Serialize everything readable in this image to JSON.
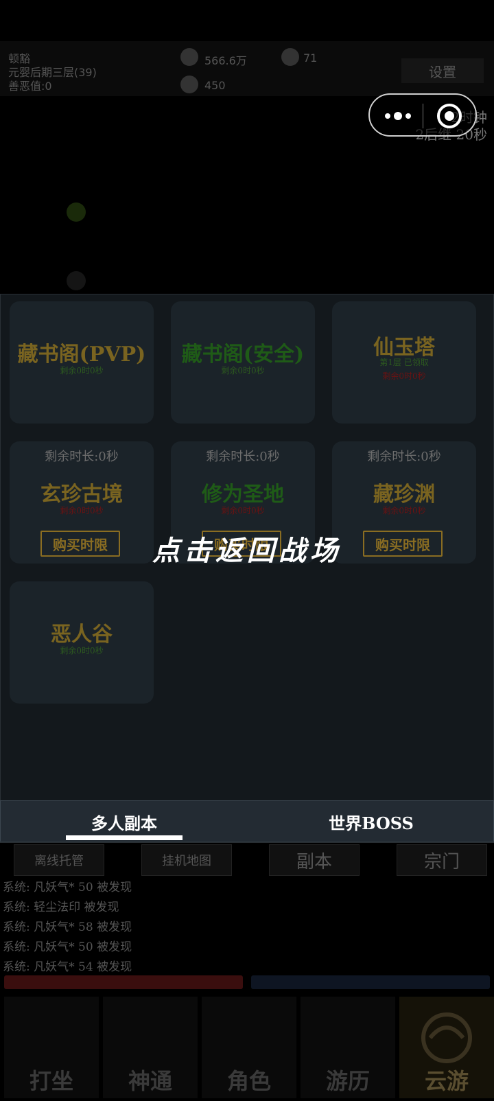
{
  "status": {
    "name": "顿豁",
    "realm": "元婴后期三层(39)",
    "karma": "善恶值:0",
    "currency1": "566.6万",
    "currency2": "71",
    "currency3": "450",
    "settings": "设置",
    "countdown1": "2时钟",
    "countdown2": "2后继",
    "countdown3": "20秒"
  },
  "panel": {
    "cards": [
      {
        "title": "藏书阁(PVP)",
        "sub1": "剩余0时0秒"
      },
      {
        "title": "藏书阁(安全)",
        "sub1": "剩余0时0秒"
      },
      {
        "title": "仙玉塔",
        "sub1": "第1层 已领取",
        "sub2": "剩余0时0秒"
      },
      {
        "remain": "剩余时长:0秒",
        "title": "玄珍古境",
        "sub1": "剩余0时0秒",
        "buy": "购买时限"
      },
      {
        "remain": "剩余时长:0秒",
        "title": "修为圣地",
        "sub1": "剩余0时0秒",
        "buy": "购买时限"
      },
      {
        "remain": "剩余时长:0秒",
        "title": "藏珍渊",
        "sub1": "剩余0时0秒",
        "buy": "购买时限"
      },
      {
        "title": "恶人谷",
        "sub1": "剩余0时0秒"
      }
    ],
    "tabs": {
      "tab1": "多人副本",
      "tab2": "世界BOSS"
    }
  },
  "overlay": {
    "return_text": "点击返回战场"
  },
  "bottom": {
    "tabs": [
      "离线托管",
      "挂机地图",
      "副本",
      "宗门"
    ],
    "log": [
      "系统: 凡妖气* 50  被发现",
      "系统: 轻尘法印  被发现",
      "系统: 凡妖气* 58  被发现",
      "系统: 凡妖气* 50  被发现",
      "系统: 凡妖气* 54  被发现"
    ],
    "nav": [
      "打坐",
      "神通",
      "角色",
      "游历",
      "云游"
    ]
  },
  "colors": {
    "panel_bg": "#13181c",
    "card_bg": "#1b2329",
    "gold": "#7a6420",
    "green": "#1f5b17",
    "red": "#6b1212"
  }
}
